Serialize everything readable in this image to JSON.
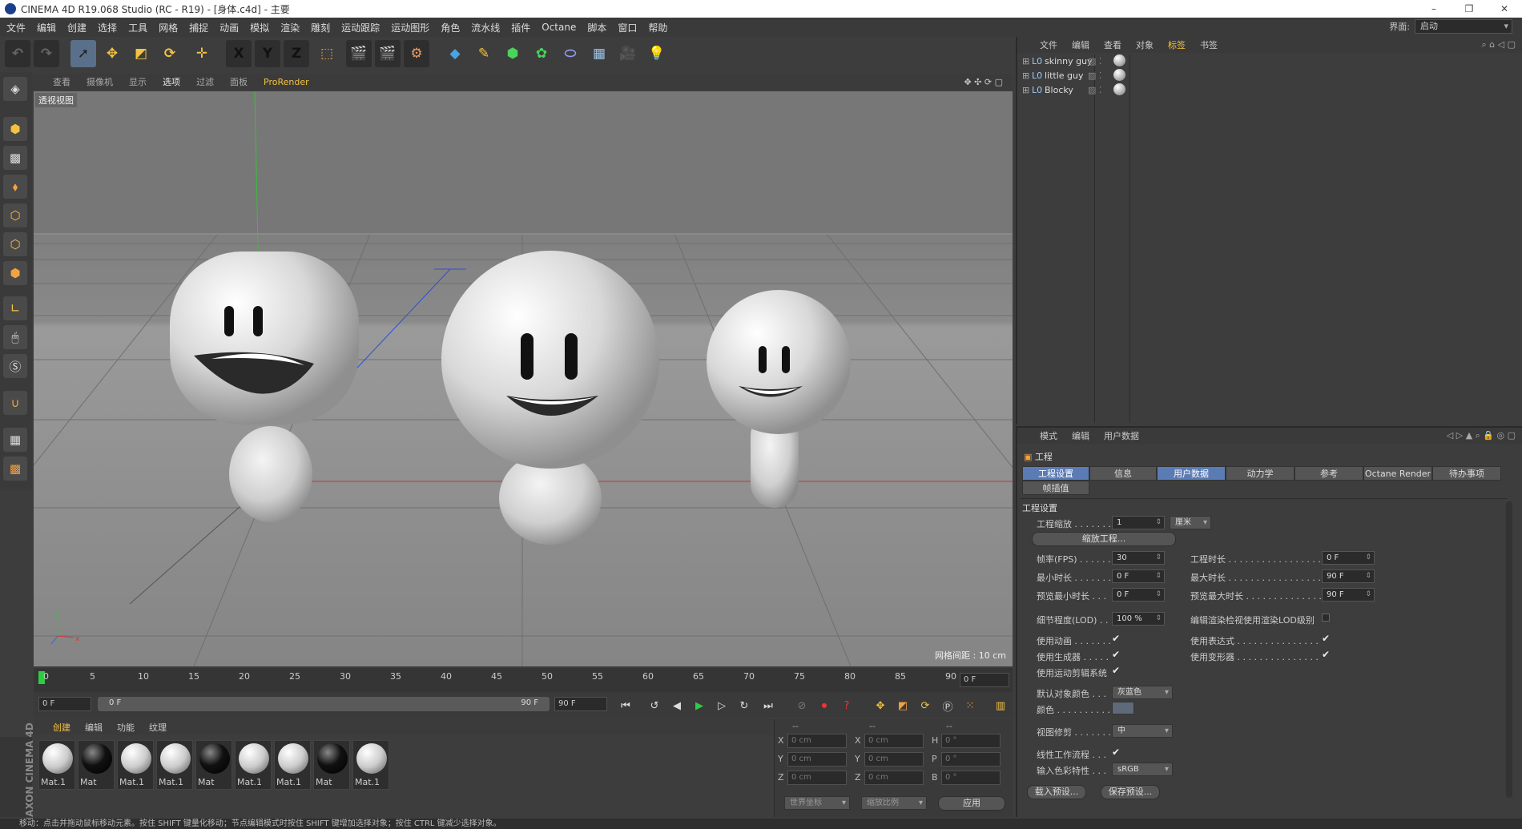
{
  "window": {
    "title": "CINEMA 4D R19.068 Studio (RC - R19) - [身体.c4d] - 主要",
    "controls": [
      "–",
      "❐",
      "✕"
    ]
  },
  "menubar": [
    "文件",
    "编辑",
    "创建",
    "选择",
    "工具",
    "网格",
    "捕捉",
    "动画",
    "模拟",
    "渲染",
    "雕刻",
    "运动跟踪",
    "运动图形",
    "角色",
    "流水线",
    "插件",
    "Octane",
    "脚本",
    "窗口",
    "帮助"
  ],
  "layout": {
    "label": "界面:",
    "value": "启动"
  },
  "toolbar_axes": [
    "X",
    "Y",
    "Z"
  ],
  "viewport": {
    "menu": [
      "查看",
      "摄像机",
      "显示",
      "选项",
      "过滤",
      "面板",
      "ProRender"
    ],
    "highlighted": "选项",
    "label": "透视视图",
    "grid_info": "网格间距 : 10 cm"
  },
  "timeline": {
    "ticks": [
      "0",
      "5",
      "10",
      "15",
      "20",
      "25",
      "30",
      "35",
      "40",
      "45",
      "50",
      "55",
      "60",
      "65",
      "70",
      "75",
      "80",
      "85",
      "90"
    ],
    "current_frame": "0 F",
    "start": "0 F",
    "range_left": "0 F",
    "range_right": "90 F",
    "end": "90 F"
  },
  "material_menu": [
    "创建",
    "编辑",
    "功能",
    "纹理"
  ],
  "materials": [
    {
      "name": "Mat.1",
      "tone": "light"
    },
    {
      "name": "Mat",
      "tone": "dark"
    },
    {
      "name": "Mat.1",
      "tone": "light"
    },
    {
      "name": "Mat.1",
      "tone": "light"
    },
    {
      "name": "Mat",
      "tone": "dark"
    },
    {
      "name": "Mat.1",
      "tone": "light"
    },
    {
      "name": "Mat.1",
      "tone": "light"
    },
    {
      "name": "Mat",
      "tone": "dark"
    },
    {
      "name": "Mat.1",
      "tone": "light"
    }
  ],
  "coords": {
    "headers": [
      "--",
      "--",
      "--"
    ],
    "rows": [
      {
        "a": "X",
        "av": "0 cm",
        "b": "X",
        "bv": "0 cm",
        "c": "H",
        "cv": "0 °"
      },
      {
        "a": "Y",
        "av": "0 cm",
        "b": "Y",
        "bv": "0 cm",
        "c": "P",
        "cv": "0 °"
      },
      {
        "a": "Z",
        "av": "0 cm",
        "b": "Z",
        "bv": "0 cm",
        "c": "B",
        "cv": "0 °"
      }
    ],
    "world": "世界坐标",
    "scale": "缩放比例",
    "apply": "应用"
  },
  "brand": "MAXON CINEMA 4D",
  "status": "移动：点击并拖动鼠标移动元素。按住 SHIFT 键量化移动；节点编辑模式时按住 SHIFT 键增加选择对象；按住 CTRL 键减少选择对象。",
  "object_manager": {
    "menu": [
      "文件",
      "编辑",
      "查看",
      "对象",
      "标签",
      "书签"
    ],
    "objects": [
      "skinny guy",
      "little guy",
      "Blocky"
    ]
  },
  "attribute_manager": {
    "menu": [
      "模式",
      "编辑",
      "用户数据"
    ],
    "title": "工程",
    "tabs": [
      "工程设置",
      "信息",
      "用户数据",
      "动力学",
      "参考",
      "Octane Render",
      "待办事项",
      "帧插值"
    ],
    "section": "工程设置",
    "fields": {
      "scale_label": "工程缩放 . . . . . . .",
      "scale_value": "1",
      "scale_unit": "厘米",
      "scale_button": "缩放工程...",
      "fps_label": "帧率(FPS) . . . . . .",
      "fps_value": "30",
      "duration_label": "工程时长 . . . . . . . . . . . . . . . . .",
      "duration_value": "0 F",
      "min_label": "最小时长 . . . . . . .",
      "min_value": "0 F",
      "max_label": "最大时长 . . . . . . . . . . . . . . . . .",
      "max_value": "90 F",
      "pmin_label": "预览最小时长 . . .",
      "pmin_value": "0 F",
      "pmax_label": "预览最大时长 . . . . . . . . . . . . . .",
      "pmax_value": "90 F",
      "lod_label": "细节程度(LOD) . .",
      "lod_value": "100 %",
      "lod_render_label": "编辑渲染检视使用渲染LOD级别",
      "anim_label": "使用动画 . . . . . . .",
      "expr_label": "使用表达式 . . . . . . . . . . . . . . .",
      "gen_label": "使用生成器 . . . . .",
      "deform_label": "使用变形器 . . . . . . . . . . . . . . .",
      "motion_label": "使用运动剪辑系统",
      "color_label": "默认对象颜色 . . .",
      "color_value": "灰蓝色",
      "color2_label": "颜色 . . . . . . . . . .",
      "clip_label": "视图修剪 . . . . . . .",
      "clip_value": "中",
      "linear_label": "线性工作流程 . . .",
      "profile_label": "输入色彩特性 . . .",
      "profile_value": "sRGB",
      "load_preset": "载入预设...",
      "save_preset": "保存预设..."
    }
  }
}
